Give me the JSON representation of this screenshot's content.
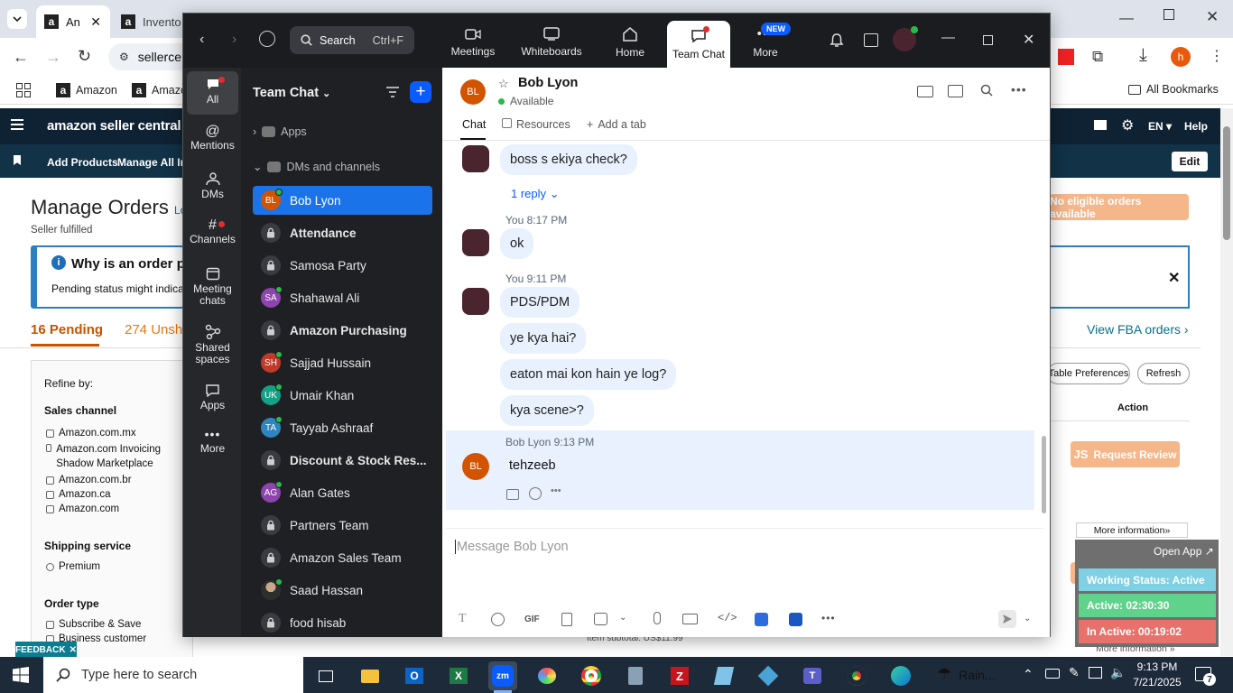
{
  "browser": {
    "tabs": [
      {
        "label": "An",
        "favicon": "a"
      },
      {
        "label": "Invento",
        "favicon": "a"
      }
    ],
    "omnibox_text": "sellerce",
    "bookmarks": [
      "Amazon",
      "Amazo"
    ],
    "all_bookmarks": "All Bookmarks",
    "profile_initial": "h"
  },
  "amazon": {
    "logo": "amazon seller central",
    "lang": "EN",
    "help": "Help",
    "nav": [
      "Add Products",
      "Manage All Inve"
    ],
    "edit": "Edit",
    "page_title": "Manage Orders",
    "page_title_suffix": "Lo",
    "subtitle": "Seller fulfilled",
    "no_orders_btn": "No eligible orders available",
    "info_title": "Why is an order pe",
    "info_body": "Pending status might indicat",
    "tab_pending": "16 Pending",
    "tab_unshipped": "274 Unshi",
    "view_fba": "View FBA orders",
    "table_prefs": "Table Preferences",
    "refresh": "Refresh",
    "action_header": "Action",
    "request_review": "Request Review",
    "more_info": "More information",
    "more_info2": "More information",
    "item_subtotal": "Item subtotal: US$11.99",
    "refine_by": "Refine by:",
    "sales_channel": "Sales channel",
    "channels": [
      "Amazon.com.mx",
      "Amazon.com Invoicing Shadow Marketplace",
      "Amazon.com.br",
      "Amazon.ca",
      "Amazon.com"
    ],
    "shipping_service": "Shipping service",
    "shipping_options": [
      "Premium"
    ],
    "order_type": "Order type",
    "order_types": [
      "Subscribe & Save",
      "Business customer"
    ],
    "feedback": "FEEDBACK"
  },
  "zoom": {
    "search_label": "Search",
    "search_shortcut": "Ctrl+F",
    "top_nav": [
      {
        "label": "Meetings",
        "icon": "video-icon"
      },
      {
        "label": "Whiteboards",
        "icon": "whiteboard-icon"
      },
      {
        "label": "Home",
        "icon": "home-icon"
      },
      {
        "label": "Team Chat",
        "icon": "chat-icon"
      },
      {
        "label": "More",
        "icon": "more-icon",
        "badge": "NEW"
      }
    ],
    "rail": [
      {
        "label": "All",
        "icon": "chat-bubble-icon"
      },
      {
        "label": "Mentions",
        "icon": "at-icon"
      },
      {
        "label": "DMs",
        "icon": "people-icon"
      },
      {
        "label": "Channels",
        "icon": "hash-icon"
      },
      {
        "label": "Meeting chats",
        "icon": "calendar-icon"
      },
      {
        "label": "Shared spaces",
        "icon": "shared-icon"
      },
      {
        "label": "Apps",
        "icon": "apps-icon"
      },
      {
        "label": "More",
        "icon": "ellipsis-icon"
      }
    ],
    "panel_title": "Team Chat",
    "apps_section": "Apps",
    "dms_section": "DMs and channels",
    "channels": [
      {
        "name": "Bob Lyon",
        "type": "avatar",
        "initials": "BL",
        "color": "#d35400",
        "bold": false,
        "selected": true
      },
      {
        "name": "Attendance",
        "type": "lock",
        "bold": true
      },
      {
        "name": "Samosa Party",
        "type": "lock",
        "bold": false
      },
      {
        "name": "Shahawal Ali",
        "type": "avatar",
        "initials": "SA",
        "color": "#8e44ad",
        "bold": false
      },
      {
        "name": "Amazon Purchasing",
        "type": "lock",
        "bold": true
      },
      {
        "name": "Sajjad Hussain",
        "type": "avatar",
        "initials": "SH",
        "color": "#c0392b",
        "bold": false
      },
      {
        "name": "Umair Khan",
        "type": "avatar",
        "initials": "UK",
        "color": "#16a085",
        "bold": false
      },
      {
        "name": "Tayyab Ashraaf",
        "type": "avatar",
        "initials": "TA",
        "color": "#2e86c1",
        "bold": false
      },
      {
        "name": "Discount & Stock Res...",
        "type": "lock",
        "bold": true
      },
      {
        "name": "Alan Gates",
        "type": "avatar",
        "initials": "AG",
        "color": "#8e44ad",
        "bold": false
      },
      {
        "name": "Partners Team",
        "type": "lock",
        "bold": false
      },
      {
        "name": "Amazon Sales Team",
        "type": "lock",
        "bold": false
      },
      {
        "name": "Saad Hassan",
        "type": "photo",
        "bold": false
      },
      {
        "name": "food hisab",
        "type": "lock",
        "bold": false
      }
    ],
    "contact": {
      "initials": "BL",
      "name": "Bob Lyon",
      "status": "Available"
    },
    "tabs": [
      "Chat",
      "Resources",
      "Add a tab"
    ],
    "messages": {
      "m1": "boss s ekiya check?",
      "reply": "1 reply",
      "meta2": "You 8:17 PM",
      "m2": "ok",
      "meta3": "You 9:11 PM",
      "m3": "PDS/PDM",
      "m4": "ye kya hai?",
      "m5": "eaton mai kon hain ye log?",
      "m6": "kya scene>?",
      "meta_bob_name": "Bob Lyon",
      "meta_bob_time": "9:13 PM",
      "m7": "tehzeeb"
    },
    "composer_placeholder": "Message Bob Lyon",
    "composer_gif": "GIF"
  },
  "work_widget": {
    "open_app": "Open App",
    "working_status": "Working Status: Active",
    "active": "Active: 02:30:30",
    "inactive": "In Active: 00:19:02"
  },
  "taskbar": {
    "search_placeholder": "Type here to search",
    "weather": "Rain...",
    "time": "9:13 PM",
    "date": "7/21/2025",
    "notification_count": "7"
  },
  "colors": {
    "zoom_blue": "#0b5cff",
    "zoom_selected": "#1a73e8",
    "amazon_orange": "#e47911",
    "widget_active": "#5fd38b",
    "widget_inactive": "#e8716b"
  }
}
